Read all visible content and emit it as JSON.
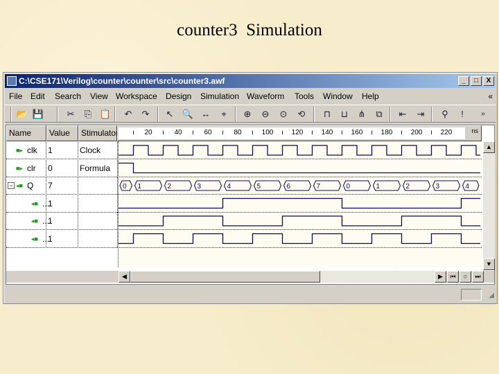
{
  "slide": {
    "title": "counter3  Simulation"
  },
  "window": {
    "title": "C:\\CSE171\\Verilog\\counter\\counter\\src\\counter3.awf",
    "min": "_",
    "max": "□",
    "close": "X"
  },
  "menu": [
    "File",
    "Edit",
    "Search",
    "View",
    "Workspace",
    "Design",
    "Simulation",
    "Waveform",
    "Tools",
    "Window",
    "Help"
  ],
  "menu_overflow": "«",
  "toolbar_overflow": "»",
  "columns": {
    "name": "Name",
    "value": "Value",
    "stimulator": "Stimulator"
  },
  "ruler": {
    "ticks": [
      "20",
      "40",
      "60",
      "80",
      "100",
      "120",
      "140",
      "160",
      "180",
      "200",
      "220"
    ],
    "unit": "ns"
  },
  "signals": [
    {
      "name": "clk",
      "value": "1",
      "stimulator": "Clock",
      "type": "input"
    },
    {
      "name": "clr",
      "value": "0",
      "stimulator": "Formula",
      "type": "input"
    },
    {
      "name": "Q",
      "value": "7",
      "stimulator": "",
      "type": "bus",
      "expanded": true
    },
    {
      "name": "...",
      "value": "1",
      "stimulator": "",
      "type": "bit"
    },
    {
      "name": "...",
      "value": "1",
      "stimulator": "",
      "type": "bit"
    },
    {
      "name": "...",
      "value": "1",
      "stimulator": "",
      "type": "bit"
    }
  ],
  "chart_data": {
    "type": "line",
    "xunit": "ns",
    "xlim": [
      0,
      245
    ],
    "clk": {
      "first_rise": 10,
      "period": 20,
      "high": 10
    },
    "clr": [
      [
        0,
        1
      ],
      [
        10,
        0
      ]
    ],
    "Q": {
      "times": [
        0,
        10,
        30,
        50,
        70,
        90,
        110,
        130,
        150,
        170,
        190,
        210,
        230
      ],
      "values": [
        "0",
        "1",
        "2",
        "3",
        "4",
        "5",
        "6",
        "7",
        "0",
        "1",
        "2",
        "3",
        "4"
      ]
    }
  },
  "colors": {
    "wave": "#0a0a50",
    "title_start": "#0a246a",
    "title_end": "#a6caf0",
    "input_icon": "#1a9a1a"
  }
}
